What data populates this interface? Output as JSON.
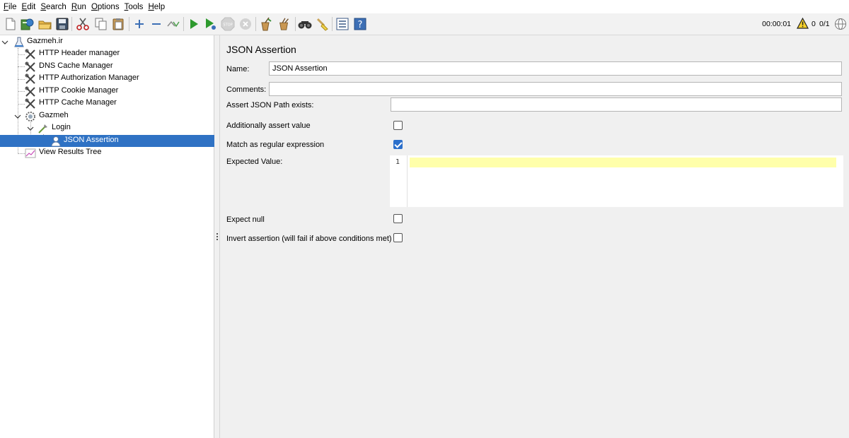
{
  "menu": [
    {
      "mn": "F",
      "rest": "ile"
    },
    {
      "mn": "E",
      "rest": "dit"
    },
    {
      "mn": "S",
      "rest": "earch"
    },
    {
      "mn": "R",
      "rest": "un"
    },
    {
      "mn": "O",
      "rest": "ptions"
    },
    {
      "mn": "T",
      "rest": "ools"
    },
    {
      "mn": "H",
      "rest": "elp"
    }
  ],
  "toolbar": {
    "timer": "00:00:01",
    "error_count": "0",
    "threads": "0/1",
    "icons": [
      "new-icon",
      "templates-icon",
      "open-icon",
      "save-icon",
      "cut-icon",
      "copy-icon",
      "paste-icon",
      "expand-icon",
      "collapse-icon",
      "toggle-icon",
      "start-icon",
      "start-no-pause-icon",
      "stop-icon",
      "shutdown-icon",
      "clear-icon",
      "clear-all-icon",
      "search-icon",
      "reset-search-icon",
      "function-helper-icon",
      "help-icon"
    ]
  },
  "tree": {
    "root": "Gazmeh.ir",
    "items": [
      "HTTP Header manager",
      "DNS Cache Manager",
      "HTTP Authorization Manager",
      "HTTP Cookie Manager",
      "HTTP Cache Manager"
    ],
    "thread_group": "Gazmeh",
    "sampler": "Login",
    "assertion": "JSON Assertion",
    "listener": "View Results Tree"
  },
  "panel": {
    "title": "JSON Assertion",
    "name_label": "Name:",
    "name_value": "JSON Assertion",
    "comments_label": "Comments:",
    "comments_value": "",
    "path_label": "Assert JSON Path exists:",
    "path_value": "",
    "additionally_label": "Additionally assert value",
    "additionally_checked": false,
    "regex_label": "Match as regular expression",
    "regex_checked": true,
    "expected_label": "Expected Value:",
    "expected_line_number": "1",
    "expect_null_label": "Expect null",
    "expect_null_checked": false,
    "invert_label": "Invert assertion (will fail if above conditions met)",
    "invert_checked": false
  }
}
